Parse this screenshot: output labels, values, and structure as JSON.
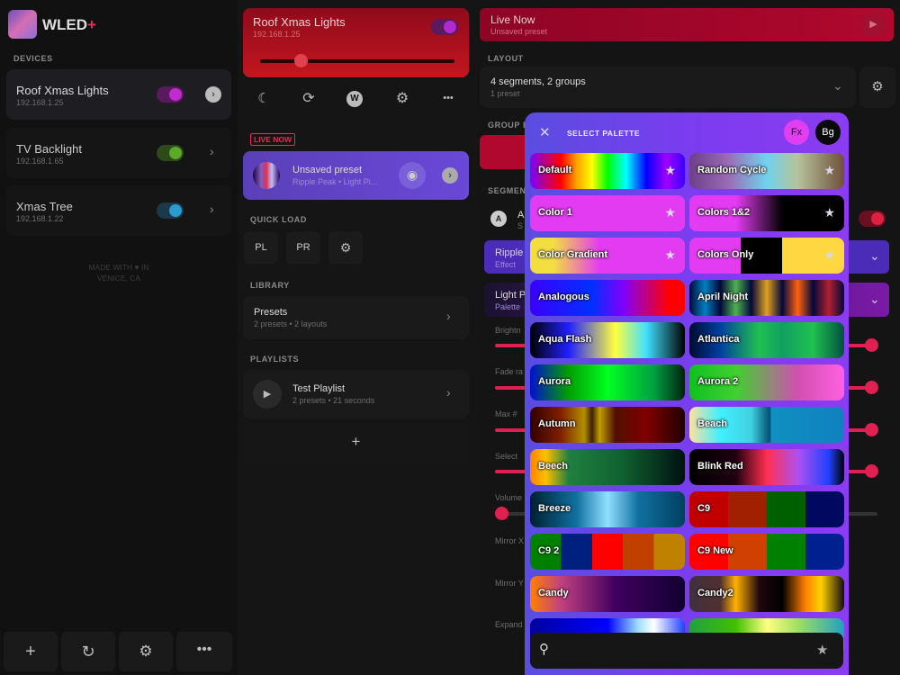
{
  "app": {
    "name": "WLED",
    "plus": "+"
  },
  "sidebar": {
    "section_devices": "DEVICES",
    "devices": [
      {
        "name": "Roof Xmas Lights",
        "ip": "192.168.1.25",
        "on": true,
        "color": "#c02bd0"
      },
      {
        "name": "TV Backlight",
        "ip": "192.168.1.65",
        "on": true,
        "color": "#5caa2a"
      },
      {
        "name": "Xmas Tree",
        "ip": "192.168.1.22",
        "on": true,
        "color": "#2a9bd0"
      }
    ],
    "made_with": "MADE WITH ♥ IN",
    "location": "VENICE, CA",
    "footer_icons": [
      "plus-icon",
      "refresh-icon",
      "gear-icon",
      "more-icon"
    ]
  },
  "device": {
    "title": "Roof Xmas Lights",
    "ip": "192.168.1.25",
    "brightness": 0.18,
    "toolbar_icons": [
      "moon-icon",
      "sync-icon",
      "wled-icon",
      "gear-icon",
      "more-icon"
    ],
    "live_badge": "LIVE NOW",
    "live_preset": {
      "title": "Unsaved preset",
      "subtitle": "Ripple Peak • Light Pi..."
    },
    "quick_load_label": "QUICK LOAD",
    "quick_load": [
      "PL",
      "PR"
    ],
    "library_label": "LIBRARY",
    "library": {
      "title": "Presets",
      "subtitle": "2 presets • 2 layouts"
    },
    "playlists_label": "PLAYLISTS",
    "playlist": {
      "title": "Test Playlist",
      "subtitle": "2 presets • 21 seconds"
    },
    "add": "+"
  },
  "right": {
    "live_title": "Live Now",
    "live_subtitle": "Unsaved preset",
    "layout_label": "LAYOUT",
    "layout_title": "4 segments, 2 groups",
    "layout_subtitle": "1 preset",
    "group_label": "GROUP BY",
    "segments_label": "SEGMENT",
    "seg_badge": "A",
    "seg_name": "A",
    "seg_sub": "S",
    "effect_title": "Ripple",
    "effect_sub": "Effect",
    "palette_title": "Light P",
    "palette_sub": "Palette",
    "params": [
      "Brightn",
      "Fade ra",
      "Max #",
      "Select",
      "Volume",
      "Mirror X",
      "Mirror Y",
      "Expand"
    ]
  },
  "modal": {
    "title": "SELECT PALETTE",
    "fx": "Fx",
    "bg": "Bg",
    "palettes": [
      {
        "name": "Default",
        "star": true,
        "grad": "linear-gradient(90deg,#7a00ff,#ff0000 20%,#ffa000 30%,#ffff00 40%,#00ff00 50%,#00ffff 62%,#0000ff 75%,#a000ff 88%,#3a00ff)"
      },
      {
        "name": "Random Cycle",
        "star": true,
        "grad": "linear-gradient(90deg,#6d3f8a,#9a6bb5 25%,#6fd3ee 50%,#b6c39a 70%,#6e4f3b)"
      },
      {
        "name": "Color 1",
        "star": true,
        "grad": "linear-gradient(90deg,#e33bf2,#e33bf2)"
      },
      {
        "name": "Colors 1&2",
        "star": true,
        "grad": "linear-gradient(90deg,#e33bf2 30%,#000 60%,#000)"
      },
      {
        "name": "Color Gradient",
        "star": true,
        "grad": "linear-gradient(90deg,#f3de41,#f3de41 15%,#e33bf2 45%,#e33bf2)"
      },
      {
        "name": "Colors Only",
        "star": true,
        "grad": "linear-gradient(90deg,#e33bf2 0%,#e33bf2 33%,#000 33%,#000 60%,#ffd740 60%,#ffd740)"
      },
      {
        "name": "Analogous",
        "star": false,
        "grad": "linear-gradient(90deg,#3b00ff,#0030ff 40%,#8000ff 60%,#ff0000 90%,#ff0000)"
      },
      {
        "name": "April Night",
        "star": false,
        "grad": "linear-gradient(90deg,#02083a,#0080c0 10%,#02083a 20%,#50b050 30%,#02083a 40%,#e0a020 50%,#02083a 60%,#ff6010 70%,#02083a 80%,#b02030 90%,#02083a)"
      },
      {
        "name": "Aqua Flash",
        "star": false,
        "grad": "linear-gradient(90deg,#000,#2020ff 25%,#ffff40 55%,#40e0ff 75%,#000)"
      },
      {
        "name": "Atlantica",
        "star": false,
        "grad": "linear-gradient(90deg,#000a30,#0040a0 20%,#20c050 45%,#10a060 60%,#20c050 80%,#005040)"
      },
      {
        "name": "Aurora",
        "star": false,
        "grad": "linear-gradient(90deg,#0010d0,#00a000 25%,#00ff20 50%,#00a040 80%,#002010)"
      },
      {
        "name": "Aurora 2",
        "star": false,
        "grad": "linear-gradient(90deg,#10c020,#40d030 30%,#d050b0 70%,#ff60e0)"
      },
      {
        "name": "Autumn",
        "star": false,
        "grad": "linear-gradient(90deg,#300000,#802000 20%,#b09000 35%,#402000 40%,#c0a000 45%,#501000 55%,#800000 75%,#200000)"
      },
      {
        "name": "Beach",
        "star": false,
        "grad": "linear-gradient(90deg,#ffe0a0,#40f0ff 20%,#40d0e0 40%,#005070 52%,#1090c0 53%,#1080c0)"
      },
      {
        "name": "Beech",
        "star": false,
        "grad": "linear-gradient(90deg,#ff8000,#ffc000 10%,#208040 25%,#106030 60%,#001010)"
      },
      {
        "name": "Blink Red",
        "star": false,
        "grad": "linear-gradient(90deg,#000,#200010 30%,#ff3050 50%,#b050f0 70%,#2040ff 90%,#000)"
      },
      {
        "name": "Breeze",
        "star": false,
        "grad": "linear-gradient(90deg,#002030,#1070a0 30%,#90e0ff 50%,#1070a0 70%,#004060)"
      },
      {
        "name": "C9",
        "star": false,
        "grad": "linear-gradient(90deg,#c00000 0%,#c00000 25%,#a02000 25%,#a02000 50%,#006000 50%,#006000 75%,#000860 75%)"
      },
      {
        "name": "C9 2",
        "star": false,
        "grad": "linear-gradient(90deg,#008000 0%,#008000 20%,#002080 20%,#002080 40%,#ff0000 40%,#ff0000 60%,#c04000 60%,#c04000 80%,#c08000 80%)"
      },
      {
        "name": "C9 New",
        "star": false,
        "grad": "linear-gradient(90deg,#ff0000 0%,#ff0000 25%,#d04000 25%,#d04000 50%,#008000 50%,#008000 75%,#002090 75%)"
      },
      {
        "name": "Candy",
        "star": false,
        "grad": "linear-gradient(90deg,#ff8000,#c04080 20%,#400060 55%,#100030)"
      },
      {
        "name": "Candy2",
        "star": false,
        "grad": "linear-gradient(90deg,#403040,#503030 20%,#ffb000 30%,#200810 45%,#000 60%,#ff8000 75%,#ffd000 85%,#101010)"
      },
      {
        "name": "",
        "star": false,
        "grad": "linear-gradient(90deg,#0000a0,#0000ff 50%,#a0e0ff 70%,#ffffff 80%,#2040ff)"
      },
      {
        "name": "",
        "star": false,
        "grad": "linear-gradient(90deg,#20a040,#40c000 30%,#ffff80 50%,#a0e060 70%,#20a0c0)"
      }
    ],
    "search_placeholder": ""
  }
}
